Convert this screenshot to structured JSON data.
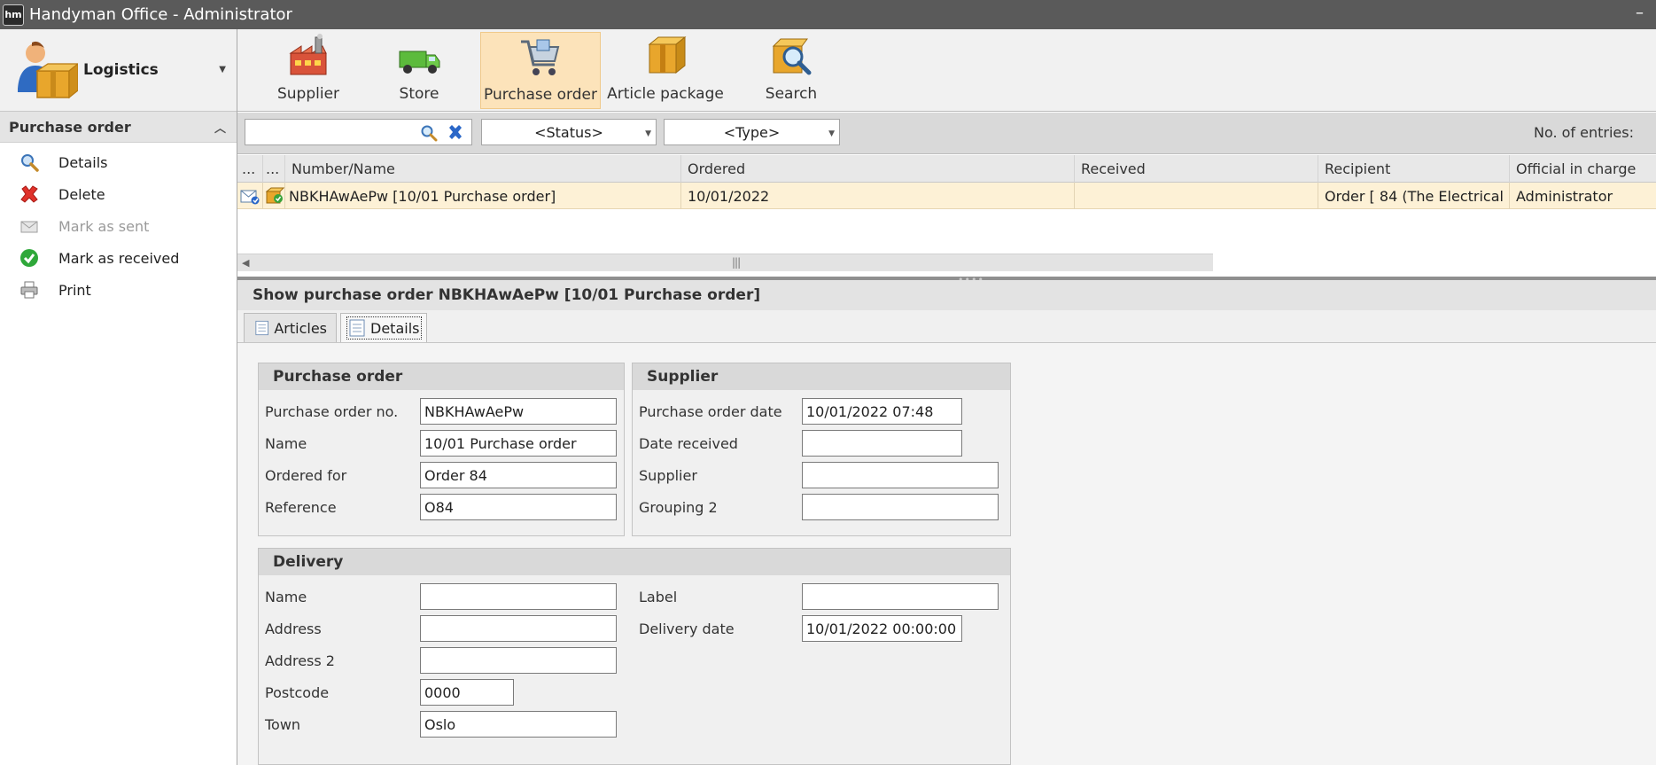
{
  "titlebar": {
    "logo_text": "hm",
    "title": "Handyman Office - Administrator",
    "minimize": "–"
  },
  "module": {
    "label": "Logistics",
    "icon": "logistics-person-box-icon"
  },
  "sidebar": {
    "section_title": "Purchase order",
    "actions": [
      {
        "label": "Details",
        "icon": "magnifier-icon",
        "enabled": true
      },
      {
        "label": "Delete",
        "icon": "red-x-icon",
        "enabled": true
      },
      {
        "label": "Mark as sent",
        "icon": "envelope-icon",
        "enabled": false
      },
      {
        "label": "Mark as received",
        "icon": "green-check-icon",
        "enabled": true
      },
      {
        "label": "Print",
        "icon": "printer-icon",
        "enabled": true
      }
    ]
  },
  "ribbon": {
    "buttons": [
      {
        "label": "Supplier",
        "icon": "factory-icon",
        "active": false
      },
      {
        "label": "Store",
        "icon": "van-icon",
        "active": false
      },
      {
        "label": "Purchase order",
        "icon": "shopping-cart-icon",
        "active": true
      },
      {
        "label": "Article package",
        "icon": "boxes-icon",
        "active": false
      },
      {
        "label": "Search",
        "icon": "search-box-icon",
        "active": false
      }
    ]
  },
  "filters": {
    "search_value": "",
    "status": "<Status>",
    "type": "<Type>",
    "entries_label": "No. of entries:"
  },
  "grid": {
    "columns": [
      "...",
      "...",
      "Number/Name",
      "Ordered",
      "Received",
      "Recipient",
      "Official in charge"
    ],
    "rows": [
      {
        "number_name": "NBKHAwAePw [10/01 Purchase order]",
        "ordered": "10/01/2022",
        "received": "",
        "recipient": "Order [ 84 (The Electrical ...",
        "official": "Administrator"
      }
    ]
  },
  "detail": {
    "title": "Show purchase order NBKHAwAePw [10/01 Purchase order]",
    "tabs": [
      "Articles",
      "Details"
    ],
    "active_tab": "Details",
    "purchase_order": {
      "title": "Purchase order",
      "fields": [
        {
          "label": "Purchase order no.",
          "value": "NBKHAwAePw"
        },
        {
          "label": "Name",
          "value": "10/01 Purchase order"
        },
        {
          "label": "Ordered for",
          "value": "Order 84"
        },
        {
          "label": "Reference",
          "value": "O84"
        }
      ]
    },
    "supplier": {
      "title": "Supplier",
      "fields": [
        {
          "label": "Purchase order date",
          "value": "10/01/2022 07:48"
        },
        {
          "label": "Date received",
          "value": ""
        },
        {
          "label": "Supplier",
          "value": ""
        },
        {
          "label": "Grouping 2",
          "value": ""
        }
      ]
    },
    "delivery": {
      "title": "Delivery",
      "left_fields": [
        {
          "label": "Name",
          "value": ""
        },
        {
          "label": "Address",
          "value": ""
        },
        {
          "label": "Address 2",
          "value": ""
        },
        {
          "label": "Postcode",
          "value": "0000"
        },
        {
          "label": "Town",
          "value": "Oslo"
        }
      ],
      "right_fields": [
        {
          "label": "Label",
          "value": ""
        },
        {
          "label": "Delivery date",
          "value": "10/01/2022 00:00:00"
        }
      ]
    }
  }
}
